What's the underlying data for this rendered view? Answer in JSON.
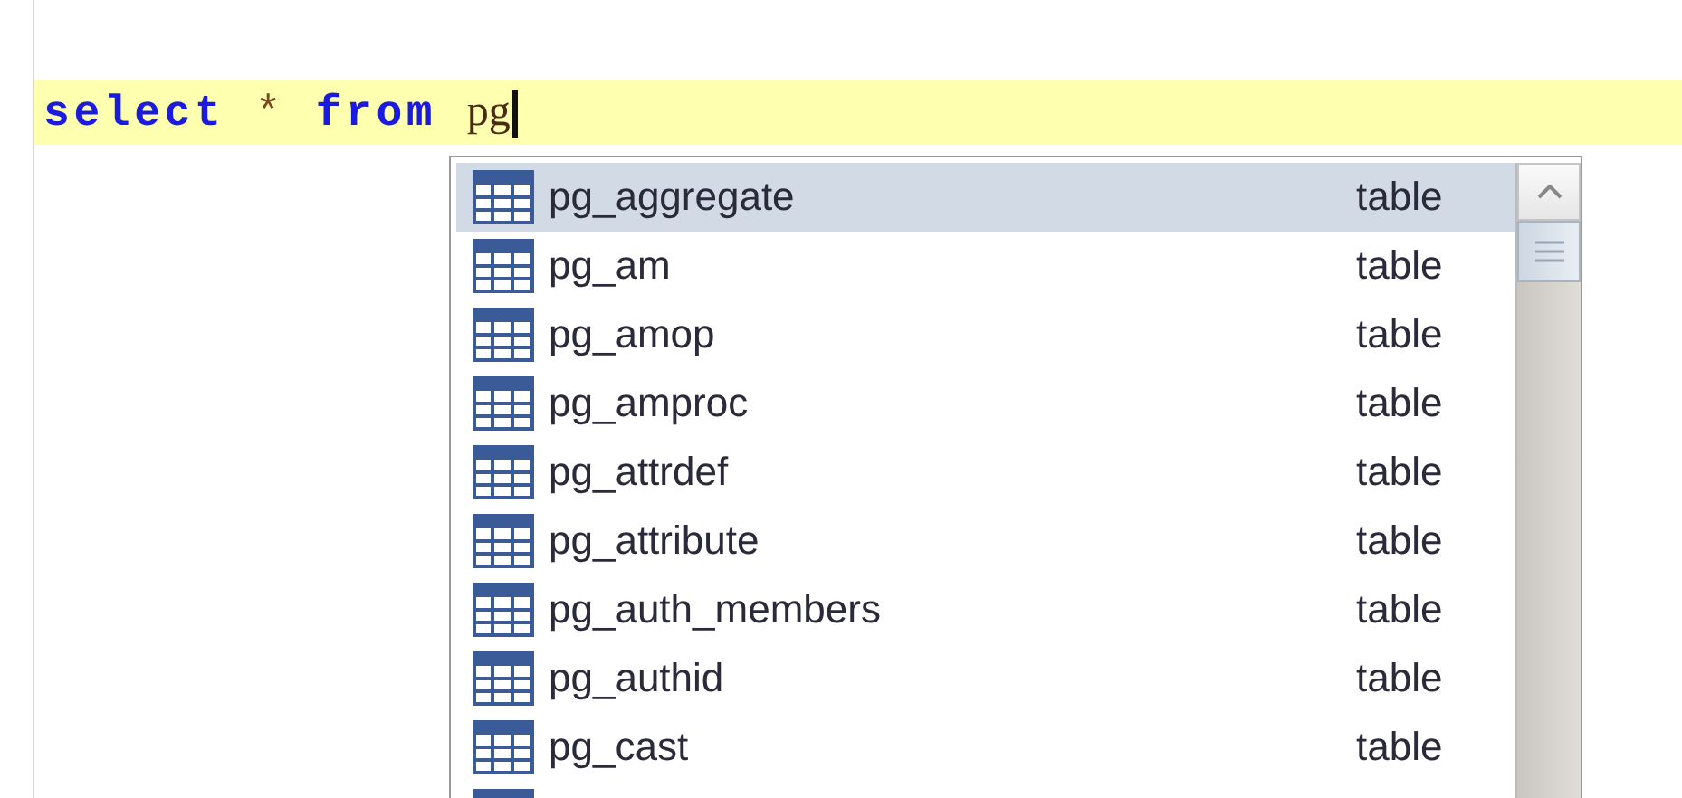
{
  "editor": {
    "tokens": [
      {
        "text": "select",
        "kind": "keyword"
      },
      {
        "text": "*",
        "kind": "operator"
      },
      {
        "text": "from",
        "kind": "keyword"
      },
      {
        "text": "pg",
        "kind": "identifier"
      }
    ]
  },
  "completion": {
    "items": [
      {
        "name": "pg_aggregate",
        "type": "table",
        "selected": true
      },
      {
        "name": "pg_am",
        "type": "table",
        "selected": false
      },
      {
        "name": "pg_amop",
        "type": "table",
        "selected": false
      },
      {
        "name": "pg_amproc",
        "type": "table",
        "selected": false
      },
      {
        "name": "pg_attrdef",
        "type": "table",
        "selected": false
      },
      {
        "name": "pg_attribute",
        "type": "table",
        "selected": false
      },
      {
        "name": "pg_auth_members",
        "type": "table",
        "selected": false
      },
      {
        "name": "pg_authid",
        "type": "table",
        "selected": false
      },
      {
        "name": "pg_cast",
        "type": "table",
        "selected": false
      }
    ]
  }
}
